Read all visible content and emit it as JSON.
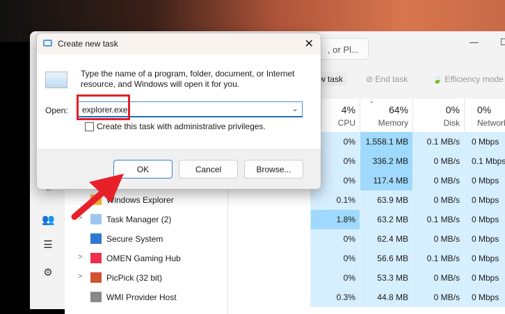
{
  "taskmanager": {
    "search_placeholder": ", or Pl...",
    "toolbar": {
      "new_task": "w task",
      "end_task": "End task",
      "efficiency": "Efficiency mode"
    },
    "columns": [
      {
        "pct": "4%",
        "label": "CPU"
      },
      {
        "pct": "64%",
        "label": "Memory"
      },
      {
        "pct": "0%",
        "label": "Disk"
      },
      {
        "pct": "0%",
        "label": "Network"
      }
    ],
    "rows": [
      {
        "name": "",
        "cpu": "0%",
        "mem": "1,558.1 MB",
        "disk": "0.1 MB/s",
        "net": "0 Mbps"
      },
      {
        "name": "",
        "cpu": "0%",
        "mem": "336.2 MB",
        "disk": "0 MB/s",
        "net": "0.1 Mbps"
      },
      {
        "name": "",
        "cpu": "0%",
        "mem": "117.4 MB",
        "disk": "0 MB/s",
        "net": "0 Mbps"
      },
      {
        "name": "Windows Explorer",
        "cpu": "0.1%",
        "mem": "63.9 MB",
        "disk": "0 MB/s",
        "net": "0 Mbps"
      },
      {
        "name": "Task Manager (2)",
        "cpu": "1.8%",
        "mem": "63.2 MB",
        "disk": "0.1 MB/s",
        "net": "0 Mbps"
      },
      {
        "name": "Secure System",
        "cpu": "0%",
        "mem": "62.4 MB",
        "disk": "0 MB/s",
        "net": "0 Mbps"
      },
      {
        "name": "OMEN Gaming Hub",
        "cpu": "0%",
        "mem": "56.6 MB",
        "disk": "0.1 MB/s",
        "net": "0 Mbps"
      },
      {
        "name": "PicPick (32 bit)",
        "cpu": "0%",
        "mem": "53.3 MB",
        "disk": "0 MB/s",
        "net": "0 Mbps"
      },
      {
        "name": "WMI Provider Host",
        "cpu": "0.3%",
        "mem": "44.8 MB",
        "disk": "0 MB/s",
        "net": "0 Mbps"
      }
    ]
  },
  "dialog": {
    "title": "Create new task",
    "message": "Type the name of a program, folder, document, or Internet resource, and Windows will open it for you.",
    "open_label": "Open:",
    "open_value": "explorer.exe",
    "admin_label": "Create this task with administrative privileges.",
    "ok": "OK",
    "cancel": "Cancel",
    "browse": "Browse..."
  }
}
